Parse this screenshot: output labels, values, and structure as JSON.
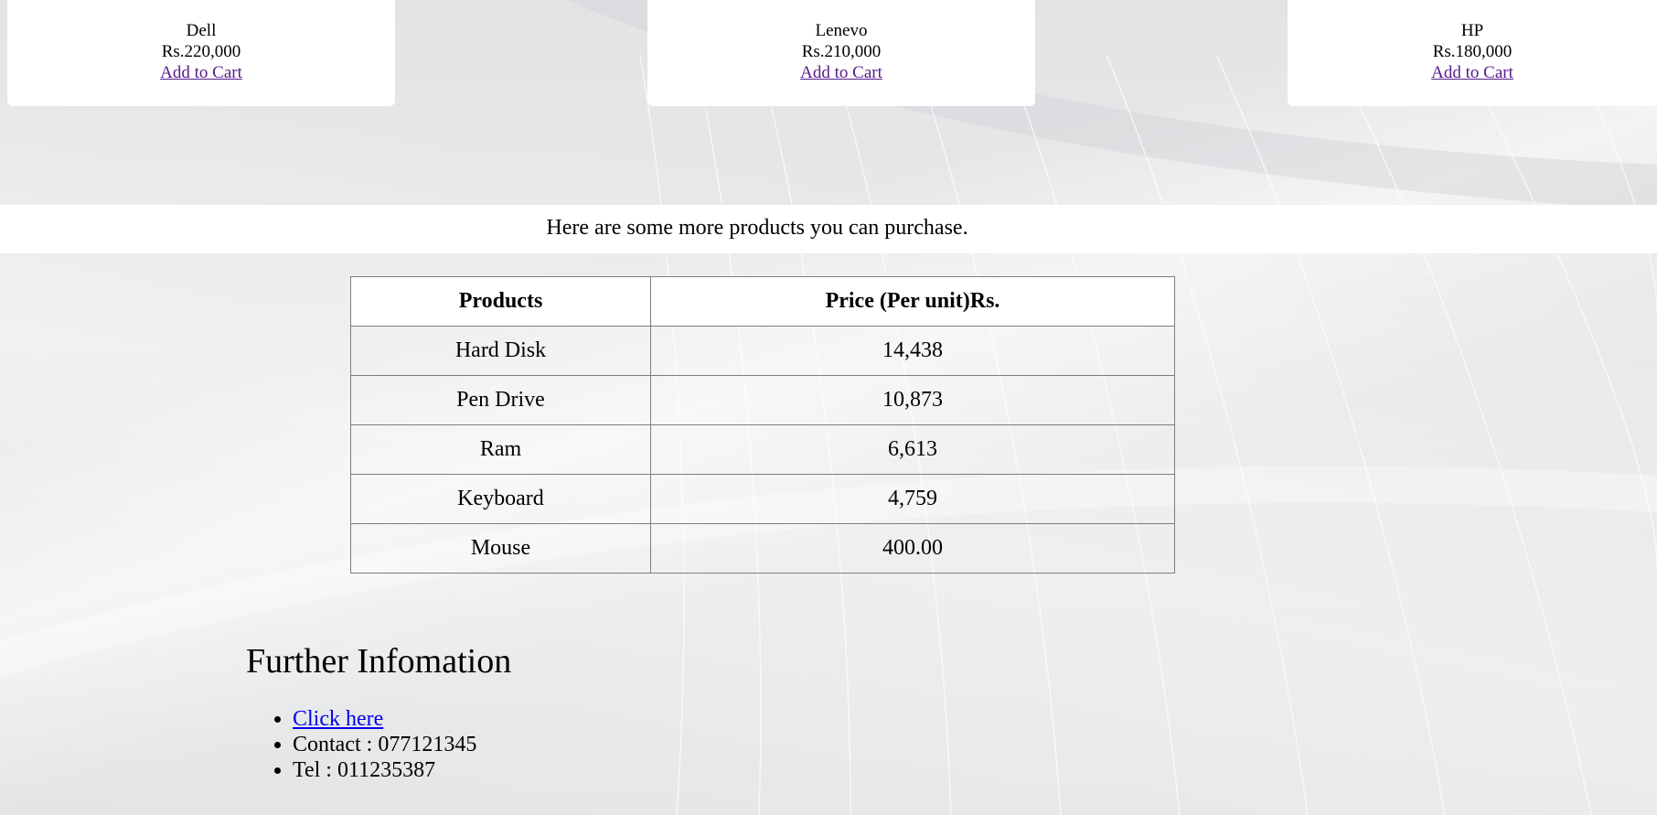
{
  "featured_products": [
    {
      "name": "Dell",
      "price": "Rs.220,000",
      "action": "Add to Cart"
    },
    {
      "name": "Lenevo",
      "price": "Rs.210,000",
      "action": "Add to Cart"
    },
    {
      "name": "HP",
      "price": "Rs.180,000",
      "action": "Add to Cart"
    }
  ],
  "promo": {
    "text": "Here are some more products you can purchase."
  },
  "products_table": {
    "headers": [
      "Products",
      "Price (Per unit)Rs."
    ],
    "rows": [
      {
        "product": "Hard Disk",
        "price": "14,438"
      },
      {
        "product": "Pen Drive",
        "price": "10,873"
      },
      {
        "product": "Ram",
        "price": "6,613"
      },
      {
        "product": "Keyboard",
        "price": "4,759"
      },
      {
        "product": "Mouse",
        "price": "400.00"
      }
    ]
  },
  "further_info": {
    "heading": "Further Infomation",
    "link_text": "Click here",
    "contact": "Contact : 077121345",
    "tel": "Tel : 011235387"
  },
  "colors": {
    "visited_link": "#551a8b",
    "link": "#0000ee",
    "card_background": "#ffffff",
    "page_background": "#e4e5e7"
  }
}
